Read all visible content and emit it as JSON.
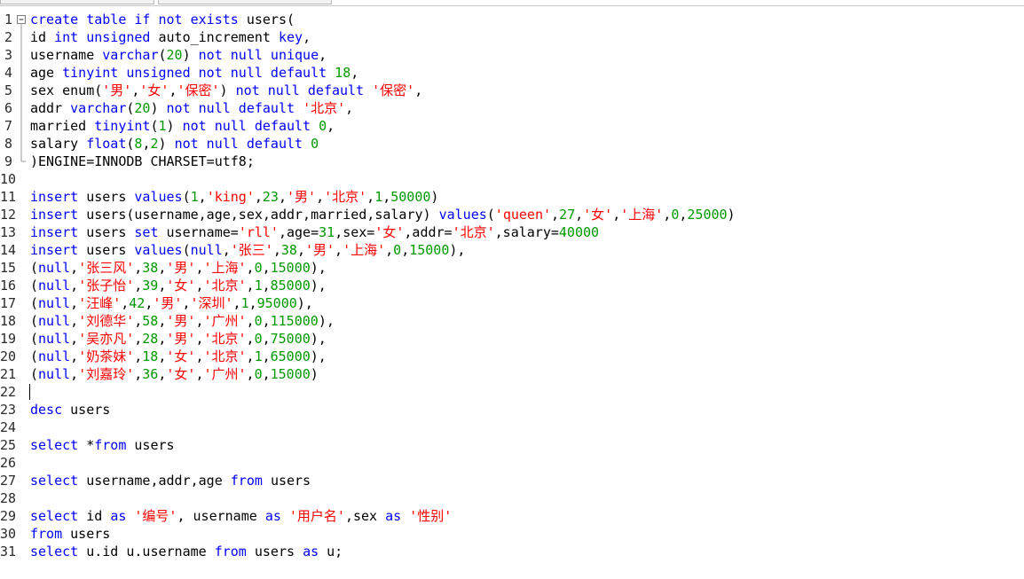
{
  "colors": {
    "keyword": "#0000ff",
    "string": "#ff0000",
    "number": "#009900",
    "text": "#000000"
  },
  "editor": {
    "cursor_line": 22,
    "lines": [
      {
        "n": "1",
        "fold": "open",
        "tokens": [
          [
            "k",
            "create table if not exists "
          ],
          [
            "t",
            "users("
          ]
        ]
      },
      {
        "n": "2",
        "tokens": [
          [
            "t",
            "id "
          ],
          [
            "k",
            "int unsigned "
          ],
          [
            "t",
            "auto_increment "
          ],
          [
            "k",
            "key"
          ],
          [
            "t",
            ","
          ]
        ]
      },
      {
        "n": "3",
        "tokens": [
          [
            "t",
            "username "
          ],
          [
            "k",
            "varchar"
          ],
          [
            "t",
            "("
          ],
          [
            "n",
            "20"
          ],
          [
            "t",
            ") "
          ],
          [
            "k",
            "not null unique"
          ],
          [
            "t",
            ","
          ]
        ]
      },
      {
        "n": "4",
        "tokens": [
          [
            "t",
            "age "
          ],
          [
            "k",
            "tinyint unsigned not null default "
          ],
          [
            "n",
            "18"
          ],
          [
            "t",
            ","
          ]
        ]
      },
      {
        "n": "5",
        "tokens": [
          [
            "t",
            "sex enum("
          ],
          [
            "s",
            "'男'"
          ],
          [
            "t",
            ","
          ],
          [
            "s",
            "'女'"
          ],
          [
            "t",
            ","
          ],
          [
            "s",
            "'保密'"
          ],
          [
            "t",
            ") "
          ],
          [
            "k",
            "not null default "
          ],
          [
            "s",
            "'保密'"
          ],
          [
            "t",
            ","
          ]
        ]
      },
      {
        "n": "6",
        "tokens": [
          [
            "t",
            "addr "
          ],
          [
            "k",
            "varchar"
          ],
          [
            "t",
            "("
          ],
          [
            "n",
            "20"
          ],
          [
            "t",
            ") "
          ],
          [
            "k",
            "not null default "
          ],
          [
            "s",
            "'北京'"
          ],
          [
            "t",
            ","
          ]
        ]
      },
      {
        "n": "7",
        "tokens": [
          [
            "t",
            "married "
          ],
          [
            "k",
            "tinyint"
          ],
          [
            "t",
            "("
          ],
          [
            "n",
            "1"
          ],
          [
            "t",
            ") "
          ],
          [
            "k",
            "not null default "
          ],
          [
            "n",
            "0"
          ],
          [
            "t",
            ","
          ]
        ]
      },
      {
        "n": "8",
        "tokens": [
          [
            "t",
            "salary "
          ],
          [
            "k",
            "float"
          ],
          [
            "t",
            "("
          ],
          [
            "n",
            "8"
          ],
          [
            "t",
            ","
          ],
          [
            "n",
            "2"
          ],
          [
            "t",
            ") "
          ],
          [
            "k",
            "not null default "
          ],
          [
            "n",
            "0"
          ]
        ]
      },
      {
        "n": "9",
        "fold": "end",
        "tokens": [
          [
            "t",
            ")ENGINE=INNODB CHARSET=utf8;"
          ]
        ]
      },
      {
        "n": "10",
        "tokens": []
      },
      {
        "n": "11",
        "tokens": [
          [
            "k",
            "insert "
          ],
          [
            "t",
            "users "
          ],
          [
            "k",
            "values"
          ],
          [
            "t",
            "("
          ],
          [
            "n",
            "1"
          ],
          [
            "t",
            ","
          ],
          [
            "s",
            "'king'"
          ],
          [
            "t",
            ","
          ],
          [
            "n",
            "23"
          ],
          [
            "t",
            ","
          ],
          [
            "s",
            "'男'"
          ],
          [
            "t",
            ","
          ],
          [
            "s",
            "'北京'"
          ],
          [
            "t",
            ","
          ],
          [
            "n",
            "1"
          ],
          [
            "t",
            ","
          ],
          [
            "n",
            "50000"
          ],
          [
            "t",
            ")"
          ]
        ]
      },
      {
        "n": "12",
        "tokens": [
          [
            "k",
            "insert "
          ],
          [
            "t",
            "users(username,age,sex,addr,married,salary) "
          ],
          [
            "k",
            "values"
          ],
          [
            "t",
            "("
          ],
          [
            "s",
            "'queen'"
          ],
          [
            "t",
            ","
          ],
          [
            "n",
            "27"
          ],
          [
            "t",
            ","
          ],
          [
            "s",
            "'女'"
          ],
          [
            "t",
            ","
          ],
          [
            "s",
            "'上海'"
          ],
          [
            "t",
            ","
          ],
          [
            "n",
            "0"
          ],
          [
            "t",
            ","
          ],
          [
            "n",
            "25000"
          ],
          [
            "t",
            ")"
          ]
        ]
      },
      {
        "n": "13",
        "tokens": [
          [
            "k",
            "insert "
          ],
          [
            "t",
            "users "
          ],
          [
            "k",
            "set "
          ],
          [
            "t",
            "username="
          ],
          [
            "s",
            "'rll'"
          ],
          [
            "t",
            ",age="
          ],
          [
            "n",
            "31"
          ],
          [
            "t",
            ",sex="
          ],
          [
            "s",
            "'女'"
          ],
          [
            "t",
            ",addr="
          ],
          [
            "s",
            "'北京'"
          ],
          [
            "t",
            ",salary="
          ],
          [
            "n",
            "40000"
          ]
        ]
      },
      {
        "n": "14",
        "tokens": [
          [
            "k",
            "insert "
          ],
          [
            "t",
            "users "
          ],
          [
            "k",
            "values"
          ],
          [
            "t",
            "("
          ],
          [
            "k",
            "null"
          ],
          [
            "t",
            ","
          ],
          [
            "s",
            "'张三'"
          ],
          [
            "t",
            ","
          ],
          [
            "n",
            "38"
          ],
          [
            "t",
            ","
          ],
          [
            "s",
            "'男'"
          ],
          [
            "t",
            ","
          ],
          [
            "s",
            "'上海'"
          ],
          [
            "t",
            ","
          ],
          [
            "n",
            "0"
          ],
          [
            "t",
            ","
          ],
          [
            "n",
            "15000"
          ],
          [
            "t",
            "),"
          ]
        ]
      },
      {
        "n": "15",
        "tokens": [
          [
            "t",
            "("
          ],
          [
            "k",
            "null"
          ],
          [
            "t",
            ","
          ],
          [
            "s",
            "'张三风'"
          ],
          [
            "t",
            ","
          ],
          [
            "n",
            "38"
          ],
          [
            "t",
            ","
          ],
          [
            "s",
            "'男'"
          ],
          [
            "t",
            ","
          ],
          [
            "s",
            "'上海'"
          ],
          [
            "t",
            ","
          ],
          [
            "n",
            "0"
          ],
          [
            "t",
            ","
          ],
          [
            "n",
            "15000"
          ],
          [
            "t",
            "),"
          ]
        ]
      },
      {
        "n": "16",
        "tokens": [
          [
            "t",
            "("
          ],
          [
            "k",
            "null"
          ],
          [
            "t",
            ","
          ],
          [
            "s",
            "'张子怡'"
          ],
          [
            "t",
            ","
          ],
          [
            "n",
            "39"
          ],
          [
            "t",
            ","
          ],
          [
            "s",
            "'女'"
          ],
          [
            "t",
            ","
          ],
          [
            "s",
            "'北京'"
          ],
          [
            "t",
            ","
          ],
          [
            "n",
            "1"
          ],
          [
            "t",
            ","
          ],
          [
            "n",
            "85000"
          ],
          [
            "t",
            "),"
          ]
        ]
      },
      {
        "n": "17",
        "tokens": [
          [
            "t",
            "("
          ],
          [
            "k",
            "null"
          ],
          [
            "t",
            ","
          ],
          [
            "s",
            "'汪峰'"
          ],
          [
            "t",
            ","
          ],
          [
            "n",
            "42"
          ],
          [
            "t",
            ","
          ],
          [
            "s",
            "'男'"
          ],
          [
            "t",
            ","
          ],
          [
            "s",
            "'深圳'"
          ],
          [
            "t",
            ","
          ],
          [
            "n",
            "1"
          ],
          [
            "t",
            ","
          ],
          [
            "n",
            "95000"
          ],
          [
            "t",
            "),"
          ]
        ]
      },
      {
        "n": "18",
        "tokens": [
          [
            "t",
            "("
          ],
          [
            "k",
            "null"
          ],
          [
            "t",
            ","
          ],
          [
            "s",
            "'刘德华'"
          ],
          [
            "t",
            ","
          ],
          [
            "n",
            "58"
          ],
          [
            "t",
            ","
          ],
          [
            "s",
            "'男'"
          ],
          [
            "t",
            ","
          ],
          [
            "s",
            "'广州'"
          ],
          [
            "t",
            ","
          ],
          [
            "n",
            "0"
          ],
          [
            "t",
            ","
          ],
          [
            "n",
            "115000"
          ],
          [
            "t",
            "),"
          ]
        ]
      },
      {
        "n": "19",
        "tokens": [
          [
            "t",
            "("
          ],
          [
            "k",
            "null"
          ],
          [
            "t",
            ","
          ],
          [
            "s",
            "'吴亦凡'"
          ],
          [
            "t",
            ","
          ],
          [
            "n",
            "28"
          ],
          [
            "t",
            ","
          ],
          [
            "s",
            "'男'"
          ],
          [
            "t",
            ","
          ],
          [
            "s",
            "'北京'"
          ],
          [
            "t",
            ","
          ],
          [
            "n",
            "0"
          ],
          [
            "t",
            ","
          ],
          [
            "n",
            "75000"
          ],
          [
            "t",
            "),"
          ]
        ]
      },
      {
        "n": "20",
        "tokens": [
          [
            "t",
            "("
          ],
          [
            "k",
            "null"
          ],
          [
            "t",
            ","
          ],
          [
            "s",
            "'奶茶妹'"
          ],
          [
            "t",
            ","
          ],
          [
            "n",
            "18"
          ],
          [
            "t",
            ","
          ],
          [
            "s",
            "'女'"
          ],
          [
            "t",
            ","
          ],
          [
            "s",
            "'北京'"
          ],
          [
            "t",
            ","
          ],
          [
            "n",
            "1"
          ],
          [
            "t",
            ","
          ],
          [
            "n",
            "65000"
          ],
          [
            "t",
            "),"
          ]
        ]
      },
      {
        "n": "21",
        "tokens": [
          [
            "t",
            "("
          ],
          [
            "k",
            "null"
          ],
          [
            "t",
            ","
          ],
          [
            "s",
            "'刘嘉玲'"
          ],
          [
            "t",
            ","
          ],
          [
            "n",
            "36"
          ],
          [
            "t",
            ","
          ],
          [
            "s",
            "'女'"
          ],
          [
            "t",
            ","
          ],
          [
            "s",
            "'广州'"
          ],
          [
            "t",
            ","
          ],
          [
            "n",
            "0"
          ],
          [
            "t",
            ","
          ],
          [
            "n",
            "15000"
          ],
          [
            "t",
            ")"
          ]
        ]
      },
      {
        "n": "22",
        "tokens": []
      },
      {
        "n": "23",
        "tokens": [
          [
            "k",
            "desc "
          ],
          [
            "t",
            "users"
          ]
        ]
      },
      {
        "n": "24",
        "tokens": []
      },
      {
        "n": "25",
        "tokens": [
          [
            "k",
            "select "
          ],
          [
            "t",
            "*"
          ],
          [
            "k",
            "from "
          ],
          [
            "t",
            "users"
          ]
        ]
      },
      {
        "n": "26",
        "tokens": []
      },
      {
        "n": "27",
        "tokens": [
          [
            "k",
            "select "
          ],
          [
            "t",
            "username,addr,age "
          ],
          [
            "k",
            "from "
          ],
          [
            "t",
            "users"
          ]
        ]
      },
      {
        "n": "28",
        "tokens": []
      },
      {
        "n": "29",
        "tokens": [
          [
            "k",
            "select "
          ],
          [
            "t",
            "id "
          ],
          [
            "k",
            "as "
          ],
          [
            "s",
            "'编号'"
          ],
          [
            "t",
            ", username "
          ],
          [
            "k",
            "as "
          ],
          [
            "s",
            "'用户名'"
          ],
          [
            "t",
            ",sex "
          ],
          [
            "k",
            "as "
          ],
          [
            "s",
            "'性别'"
          ]
        ]
      },
      {
        "n": "30",
        "tokens": [
          [
            "k",
            "from "
          ],
          [
            "t",
            "users"
          ]
        ]
      },
      {
        "n": "31",
        "tokens": [
          [
            "k",
            "select "
          ],
          [
            "t",
            "u.id u.username "
          ],
          [
            "k",
            "from "
          ],
          [
            "t",
            "users "
          ],
          [
            "k",
            "as "
          ],
          [
            "t",
            "u;"
          ]
        ]
      }
    ]
  }
}
